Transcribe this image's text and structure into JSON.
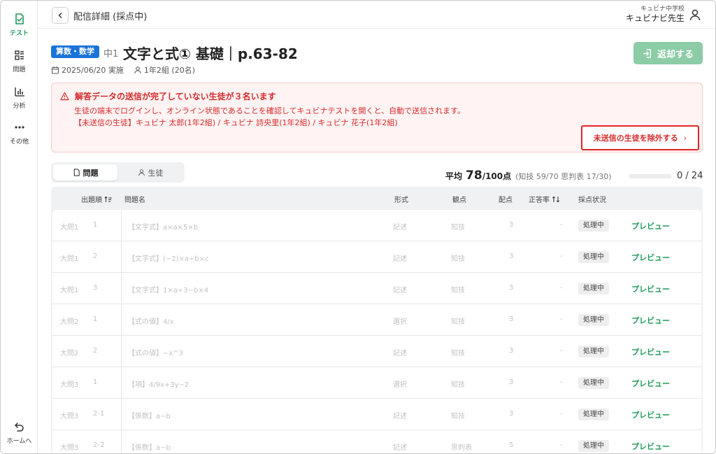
{
  "sidebar": {
    "items": [
      {
        "label": "テスト",
        "icon": "test-doc-icon",
        "active": true
      },
      {
        "label": "問題",
        "icon": "question-list-icon",
        "active": false
      },
      {
        "label": "分析",
        "icon": "bar-chart-icon",
        "active": false
      },
      {
        "label": "その他",
        "icon": "more-dots-icon",
        "active": false
      }
    ],
    "home_label": "ホームへ"
  },
  "header": {
    "title": "配信詳細 (採点中)",
    "school": "キュビナ中学校",
    "user_name": "キュビナビ先生"
  },
  "test": {
    "subject": "算数・数学",
    "grade": "中1",
    "title": "文字と式① 基礎｜p.63-82",
    "date": "2025/06/20 実施",
    "class": "1年2組 (20名)",
    "return_label": "返却する"
  },
  "alert": {
    "title": "解答データの送信が完了していない生徒が３名います",
    "message": "生徒の端末でログインし、オンライン状態であることを確認してキュビナテストを開くと、自動で送信されます。",
    "students": "【未送信の生徒】キュビナ 太郎(1年2組) / キュビナ 詩央里(1年2組) / キュビナ 花子(1年2組)",
    "action_label": "未送信の生徒を除外する",
    "action_chevron": "›"
  },
  "tabs": [
    {
      "label": "問題",
      "active": true
    },
    {
      "label": "生徒",
      "active": false
    }
  ],
  "stats": {
    "avg_label": "平均",
    "avg_value": "78",
    "avg_unit": "/100点",
    "avg_detail": "(知技 59/70  思判表 17/30)",
    "progress_count": "0 / 24",
    "progress_fraction": 0
  },
  "table": {
    "headers": {
      "order": "出題順",
      "name": "問題名",
      "format": "形式",
      "viewpoint": "観点",
      "points": "配点",
      "rate": "正答率",
      "status": "採点状況"
    },
    "rows": [
      {
        "section": "大問1",
        "num": "1",
        "name": "【文字式】a×a×5×b",
        "format": "記述",
        "viewpoint": "知技",
        "points": "3",
        "rate": "-",
        "status": "処理中",
        "action": "プレビュー"
      },
      {
        "section": "大問1",
        "num": "2",
        "name": "【文字式】(−2)×a÷b×c",
        "format": "記述",
        "viewpoint": "知技",
        "points": "3",
        "rate": "-",
        "status": "処理中",
        "action": "プレビュー"
      },
      {
        "section": "大問1",
        "num": "3",
        "name": "【文字式】1×a÷3−b×4",
        "format": "記述",
        "viewpoint": "知技",
        "points": "3",
        "rate": "-",
        "status": "処理中",
        "action": "プレビュー"
      },
      {
        "section": "大問2",
        "num": "1",
        "name": "【式の値】4/x",
        "format": "選択",
        "viewpoint": "知技",
        "points": "3",
        "rate": "-",
        "status": "処理中",
        "action": "プレビュー"
      },
      {
        "section": "大問2",
        "num": "2",
        "name": "【式の値】−x^3",
        "format": "記述",
        "viewpoint": "知技",
        "points": "3",
        "rate": "-",
        "status": "処理中",
        "action": "プレビュー"
      },
      {
        "section": "大問3",
        "num": "1",
        "name": "【項】4/9x+3y−2",
        "format": "選択",
        "viewpoint": "知技",
        "points": "3",
        "rate": "-",
        "status": "処理中",
        "action": "プレビュー"
      },
      {
        "section": "大問3",
        "num": "2-1",
        "name": "【係数】a−b",
        "format": "記述",
        "viewpoint": "知技",
        "points": "3",
        "rate": "-",
        "status": "処理中",
        "action": "プレビュー"
      },
      {
        "section": "大問3",
        "num": "2-2",
        "name": "【係数】a−b",
        "format": "記述",
        "viewpoint": "思判表",
        "points": "5",
        "rate": "-",
        "status": "処理中",
        "action": "プレビュー"
      }
    ]
  },
  "colors": {
    "accent": "#1f9a5b",
    "badge": "#1a73d9",
    "alert": "#d52b2b",
    "return_button": "#8ccca6"
  }
}
